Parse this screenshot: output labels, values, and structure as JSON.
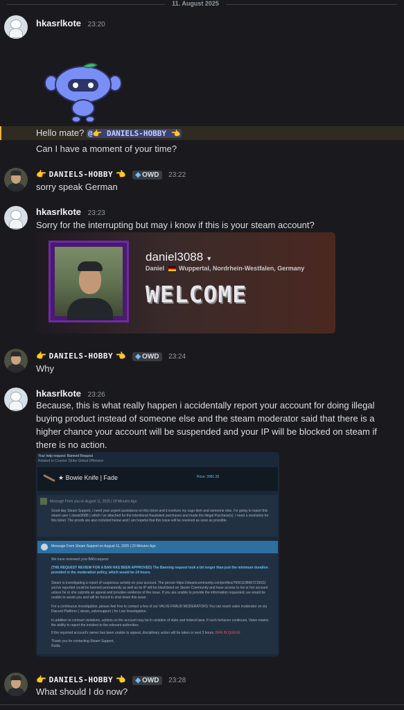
{
  "date_divider": "11. August 2025",
  "users": {
    "a": "hkasrlkote",
    "b": "DANIELS-HOBBY",
    "b_emoji": "👉",
    "b_emoji_end": "👈",
    "b_tag": "OWD"
  },
  "messages": [
    {
      "author": "hkasrlkote",
      "time": "23:20",
      "lines": [
        "Hello mate?",
        "Can I have a moment of your time?"
      ],
      "mention": "@👉 DANIELS-HOBBY 👈",
      "sticker": "blurple-robot-sticker"
    },
    {
      "author": "DANIELS-HOBBY",
      "time": "23:22",
      "text": "sorry speak German"
    },
    {
      "author": "hkasrlkote",
      "time": "23:23",
      "text": "Sorry for the interrupting but may i know if this is your steam account?"
    },
    {
      "author": "DANIELS-HOBBY",
      "time": "23:24",
      "text": "Why"
    },
    {
      "author": "hkasrlkote",
      "time": "23:26",
      "text": "Because, this is what really happen i accidentally report your account for doing illegal buying product instead of someone else and the steam moderator said that there is a higher chance your account will be suspended and your IP will be blocked on steam if there is no action."
    },
    {
      "author": "DANIELS-HOBBY",
      "time": "23:28",
      "text": "What should I do now?"
    }
  ],
  "steam_profile": {
    "username": "daniel3088",
    "real_name": "Daniel",
    "location": "Wuppertal, Nordrhein-Westfalen, Germany",
    "banner": "WELCOME"
  },
  "ticket": {
    "header": "Your help request: Banned Request",
    "subheader": "Related to Counter Strike Global Offensive",
    "item_name": "★ Bowie Knife | Fade",
    "price": "Price: 3981.39",
    "msg1_header": "Message From you on August 11, 2025 | 29 Minutes Ago",
    "msg1_body": "Good day Steam Support, I need your urgent assistance on this ticket and it involves my csgo item and someone else. I'm going to report this steam user ( daniel3088 ) which i've attached for the intentional fraudulent purchases and made the illegal Purchase(s). I need a resolution for this ticket. The proofs are also included below and I am hopeful that this issue will be resolved as soon as possible.",
    "msg2_header": "Message From Steam Support on August 11, 2025 | 23 Minutes Ago",
    "p1": "We have reviewed your BAN request:",
    "p2": "(THE REQUEST REVIEW FOR A BAN HAS BEEN APPROVED) The Banning request took a bit longer than just the minimum duration provided in the moderation policy, which would be 24 hours.",
    "p3": "Steam is investigating a report of suspicious activity on your account. The person https://steamcommunity.com/profiles/76561198967215631 you've reported could be banned permanently as well as its IP will be blacklisted on Steam Community and have access to his or her account unless he or she submits an appeal and provides evidence of the issue. If you are unable to provide the information requested, we would be unable to assist you and will be forced to shut down this issue.",
    "p4": "For a continuous investigation, please feel free to contact a few of our VALVE FRAUD MODERATORS You can reach valve moderator on via Discord Platform ( steam_valvesupport ) for Live Investigation.",
    "p5": "In addition to contract violations, actions on the account may be in violation of state and federal laws. If such behavior continues, Valve retains the ability to report the incident to the relevant authorities.",
    "p6": "If the reported account's owner has been unable to appeal, disciplinary action will be taken in next 3 hours.",
    "p6_red": "BAN IN QUEUE",
    "p7": "Thank you for contacting Steam Support,",
    "p8": "Rutila"
  }
}
